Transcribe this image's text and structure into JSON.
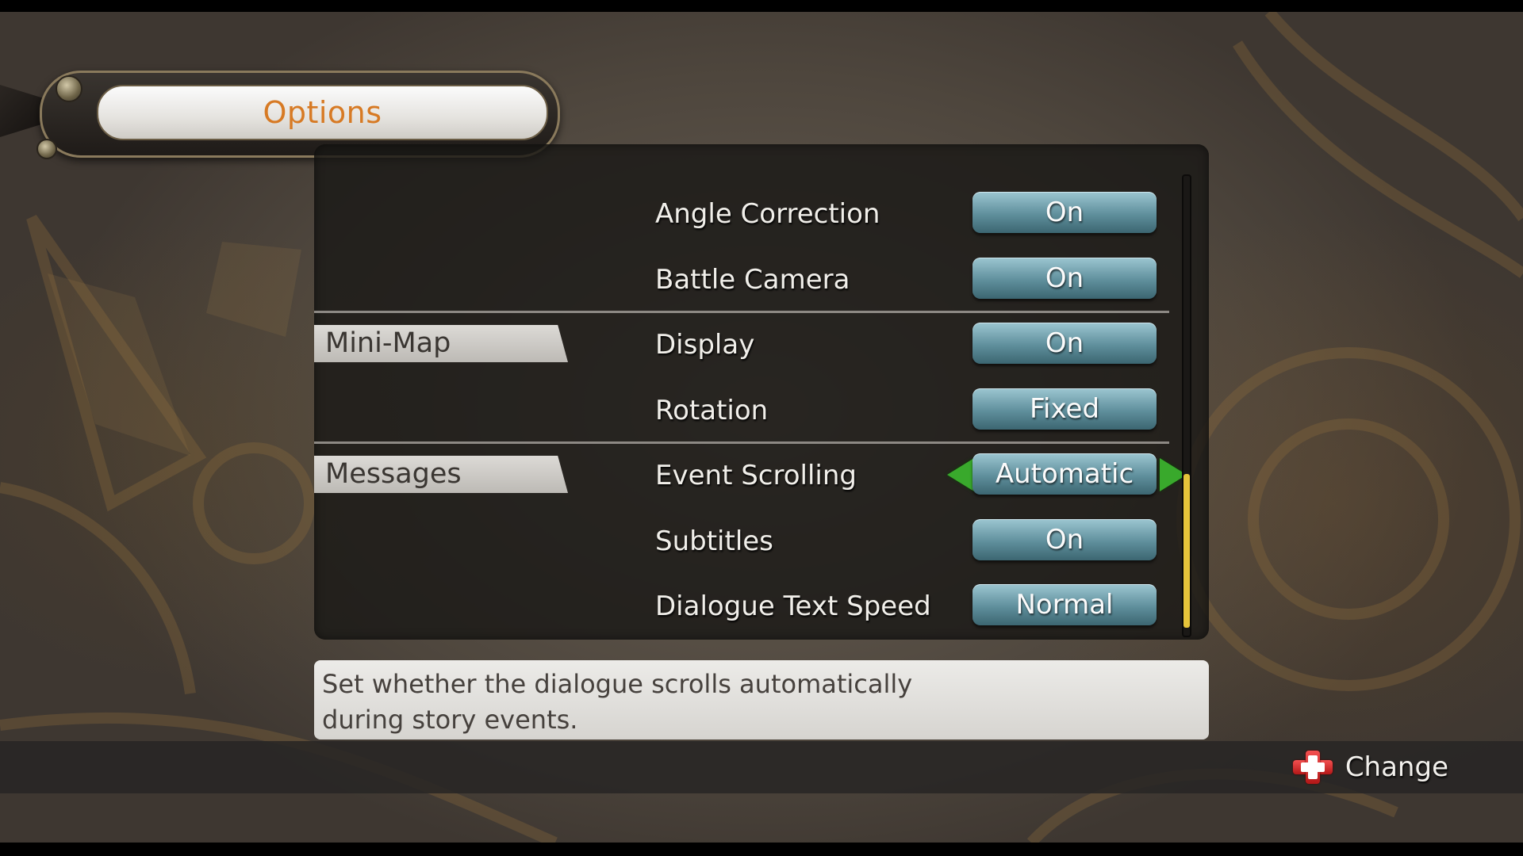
{
  "title": "Options",
  "sections": {
    "minimap": "Mini-Map",
    "messages": "Messages"
  },
  "rows": [
    {
      "label": "Angle Correction",
      "value": "On"
    },
    {
      "label": "Battle Camera",
      "value": "On"
    },
    {
      "label": "Display",
      "value": "On"
    },
    {
      "label": "Rotation",
      "value": "Fixed"
    },
    {
      "label": "Event Scrolling",
      "value": "Automatic",
      "selected": true
    },
    {
      "label": "Subtitles",
      "value": "On"
    },
    {
      "label": "Dialogue Text Speed",
      "value": "Normal"
    }
  ],
  "scroll": {
    "position": 0.7
  },
  "description": {
    "line1": "Set whether the dialogue scrolls automatically",
    "line2": "during story events."
  },
  "hint": {
    "label": "Change",
    "icon": "dpad-icon"
  },
  "colors": {
    "title": "#d77a24",
    "value_button": "#6f9eab",
    "arrow": "#39a92c",
    "scroll_thumb": "#e6c43a",
    "dpad": "#d92a2a"
  }
}
